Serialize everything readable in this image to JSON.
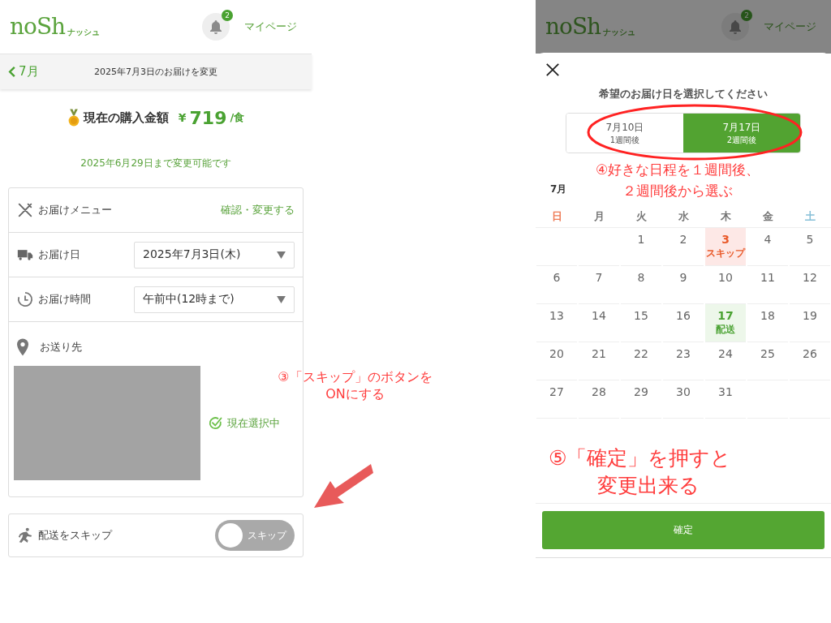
{
  "left_screen": {
    "header": {
      "logo": "noSh",
      "logo_sub": "ナッシュ",
      "notification_count": "2",
      "mypage": "マイページ"
    },
    "nav": {
      "back": "7月",
      "title": "2025年7月3日のお届けを変更"
    },
    "price": {
      "label": "現在の購入金額",
      "currency": "¥",
      "amount": "719",
      "unit": "/食"
    },
    "deadline": "2025年6月29日まで変更可能です",
    "rows": [
      {
        "kind": "link",
        "label": "お届けメニュー",
        "action": "確認・変更する"
      },
      {
        "kind": "select",
        "label": "お届け日",
        "value": "2025年7月3日(木)"
      },
      {
        "kind": "select",
        "label": "お届け時間",
        "value": "午前中(12時まで)"
      }
    ],
    "address": {
      "label": "お送り先",
      "status": "現在選択中"
    },
    "skip": {
      "label": "配送をスキップ",
      "toggle_label": "スキップ",
      "on": false
    }
  },
  "right_screen": {
    "header": {
      "logo": "noSh",
      "logo_sub": "ナッシュ",
      "notification_count": "2",
      "mypage": "マイページ"
    },
    "modal": {
      "title": "希望のお届け日を選択してください",
      "options": [
        {
          "date": "7月10日",
          "sub": "1週間後",
          "selected": false
        },
        {
          "date": "7月17日",
          "sub": "2週間後",
          "selected": true
        }
      ],
      "month": "7月",
      "weekdays": [
        {
          "label": "日",
          "color": "#ee7a55"
        },
        {
          "label": "月",
          "color": "#777777"
        },
        {
          "label": "火",
          "color": "#777777"
        },
        {
          "label": "水",
          "color": "#777777"
        },
        {
          "label": "木",
          "color": "#777777"
        },
        {
          "label": "金",
          "color": "#777777"
        },
        {
          "label": "土",
          "color": "#88c0d8"
        }
      ],
      "weeks": [
        [
          {
            "kind": "blank"
          },
          {
            "kind": "blank"
          },
          {
            "day": "1",
            "kind": "normal"
          },
          {
            "day": "2",
            "kind": "normal"
          },
          {
            "day": "3",
            "kind": "skip",
            "note": "スキップ"
          },
          {
            "day": "4",
            "kind": "normal"
          },
          {
            "day": "5",
            "kind": "normal"
          }
        ],
        [
          {
            "day": "6",
            "kind": "normal"
          },
          {
            "day": "7",
            "kind": "normal"
          },
          {
            "day": "8",
            "kind": "normal"
          },
          {
            "day": "9",
            "kind": "normal"
          },
          {
            "day": "10",
            "kind": "normal"
          },
          {
            "day": "11",
            "kind": "normal"
          },
          {
            "day": "12",
            "kind": "normal"
          }
        ],
        [
          {
            "day": "13",
            "kind": "normal"
          },
          {
            "day": "14",
            "kind": "normal"
          },
          {
            "day": "15",
            "kind": "normal"
          },
          {
            "day": "16",
            "kind": "normal"
          },
          {
            "day": "17",
            "kind": "delivery",
            "note": "配送"
          },
          {
            "day": "18",
            "kind": "normal"
          },
          {
            "day": "19",
            "kind": "normal"
          }
        ],
        [
          {
            "day": "20",
            "kind": "normal"
          },
          {
            "day": "21",
            "kind": "normal"
          },
          {
            "day": "22",
            "kind": "normal"
          },
          {
            "day": "23",
            "kind": "normal"
          },
          {
            "day": "24",
            "kind": "normal"
          },
          {
            "day": "25",
            "kind": "normal"
          },
          {
            "day": "26",
            "kind": "normal"
          }
        ],
        [
          {
            "day": "27",
            "kind": "normal"
          },
          {
            "day": "28",
            "kind": "normal"
          },
          {
            "day": "29",
            "kind": "normal"
          },
          {
            "day": "30",
            "kind": "normal"
          },
          {
            "day": "31",
            "kind": "normal"
          },
          {
            "kind": "blank"
          },
          {
            "kind": "blank"
          }
        ]
      ],
      "confirm": "確定"
    }
  },
  "annotations": [
    {
      "lines": [
        "③「スキップ」のボタンを",
        "ONにする"
      ]
    },
    {
      "lines": [
        "④好きな日程を１週間後、",
        "２週間後から選ぶ"
      ]
    },
    {
      "lines": [
        "⑤「確定」を押すと",
        "変更出来る"
      ]
    }
  ]
}
